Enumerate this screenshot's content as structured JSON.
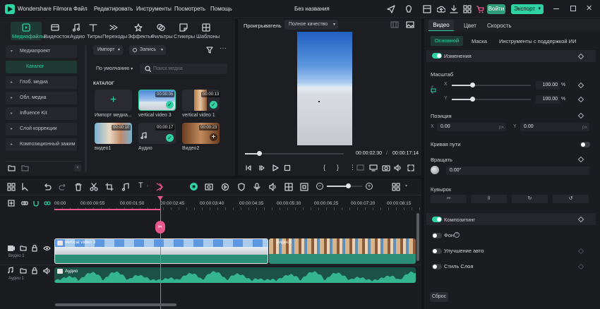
{
  "app": {
    "name": "Wondershare Filmora",
    "project_title": "Без названия"
  },
  "menu": [
    "Файл",
    "Редактировать",
    "Инструменты",
    "Посмотреть",
    "Помощь"
  ],
  "titlebar": {
    "login": "Войти",
    "export": "Экспорт"
  },
  "toolbar": [
    "Медиафайлы",
    "Видеосток",
    "Аудио",
    "Титры",
    "Переходы",
    "Эффекты",
    "Фильтры",
    "Стикеры",
    "Шаблоны"
  ],
  "sidebar": {
    "items": [
      "Медиапроект",
      "Каталог",
      "Глоб. медиа",
      "Обл. медиа",
      "Influence Kit",
      "Слой коррекции",
      "Композиционный зажим"
    ]
  },
  "media": {
    "import_btn": "Импорт",
    "record_btn": "Запись",
    "sort": "По умолчанию",
    "search_placeholder": "Поиск медиа",
    "section": "КАТАЛОГ",
    "items": [
      {
        "label": "Импорт медиа...",
        "duration": ""
      },
      {
        "label": "vertical video 3",
        "duration": "00:00:05"
      },
      {
        "label": "vertical video 1",
        "duration": "00:00:13"
      },
      {
        "label": "видео1",
        "duration": "00:00:10"
      },
      {
        "label": "Аудио",
        "duration": "00:00:17"
      },
      {
        "label": "Видео2",
        "duration": "00:00:23"
      }
    ]
  },
  "player": {
    "label": "Проигрыватель",
    "quality": "Полное качество",
    "current": "00:00:02:30",
    "total": "00:00:17:14",
    "progress": 0.14
  },
  "props": {
    "tabs": [
      "Видео",
      "Цвет",
      "Скорость"
    ],
    "subtabs": [
      "Основной",
      "Маска",
      "Инструменты с поддержкой ИИ"
    ],
    "transform": "Изменения",
    "scale": "Масштаб",
    "x_val": "100.00",
    "y_val": "100.00",
    "pct": "%",
    "x_label": "X",
    "y_label": "Y",
    "position": "Позиция",
    "pos_x": "0.00",
    "pos_y": "0.00",
    "px": "px",
    "curve": "Кривая пути",
    "rotate": "Вращать",
    "rotate_val": "0.00°",
    "flip": "Кувырок",
    "compositing": "Композитинг",
    "background": "Фон",
    "enhance": "Улучшение авто",
    "layer_style": "Стиль Слоя",
    "reset": "Сброс"
  },
  "timeline": {
    "ruler": [
      "00:00",
      "00:00:00:55",
      "00:00:01:50",
      "00:00:02:45",
      "00:00:03:40",
      "00:00:04:35",
      "00:00:05:30",
      "00:00:06:25",
      "00:00:07:20",
      "00:00:08:15"
    ],
    "video_track": "Видео 1",
    "audio_track": "Аудио 1",
    "clip1": "vertical video 3",
    "clip2": "видео1",
    "audio_clip": "Аудио"
  }
}
